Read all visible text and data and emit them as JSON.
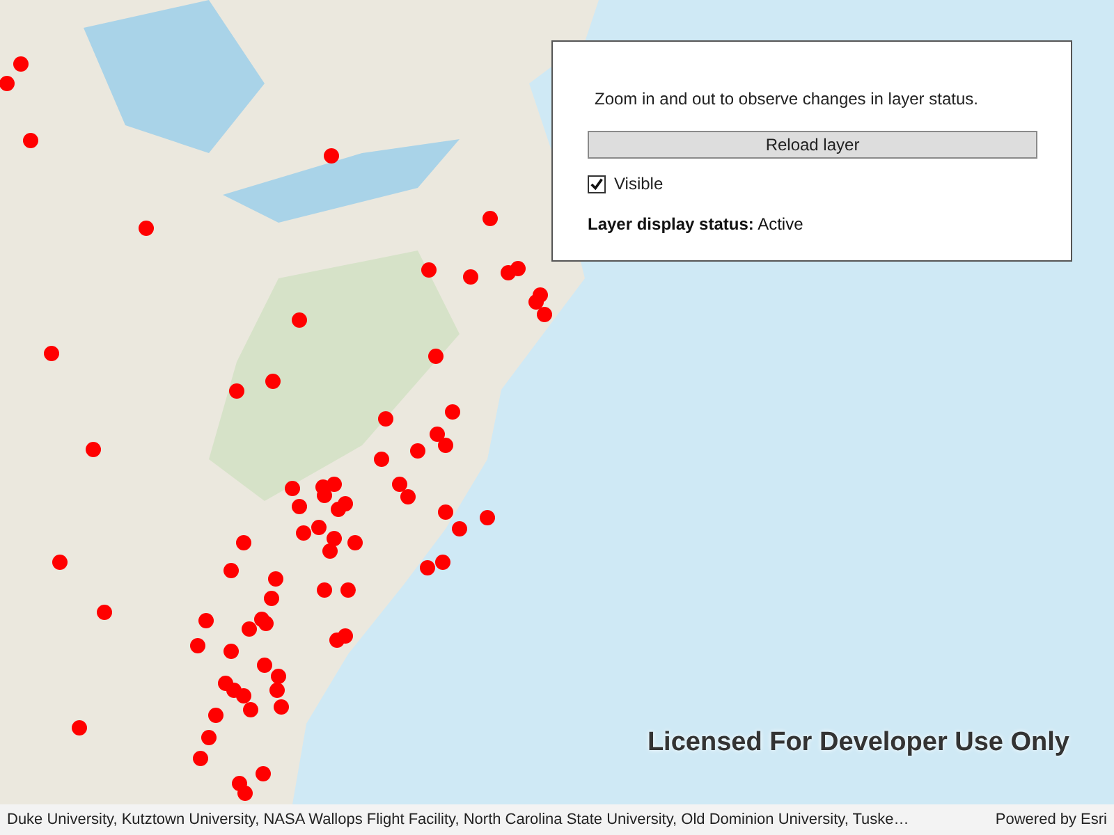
{
  "panel": {
    "instructions": "Zoom in and out to observe changes in layer status.",
    "reload_button": "Reload layer",
    "visible_checkbox": {
      "label": "Visible",
      "checked": true
    },
    "status": "**Layer display status:** Active"
  },
  "map": {
    "license_notice": "Licensed For Developer Use Only"
  },
  "attribution_bar": {
    "sources": "Duke University, Kutztown University, NASA Wallops Flight Facility, North Carolina State University, Old Dominion University, Tuske…",
    "powered_by": "Powered by Esri"
  }
}
